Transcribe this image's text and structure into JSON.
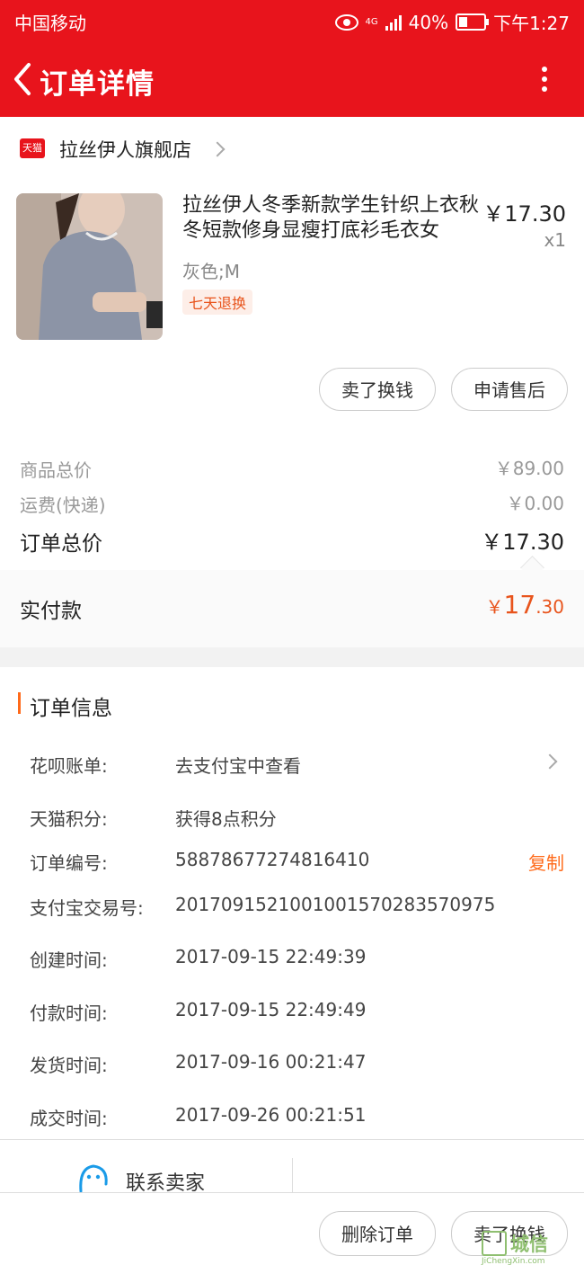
{
  "status_bar": {
    "carrier": "中国移动",
    "network": "4G",
    "battery": "40%",
    "time": "下午1:27"
  },
  "nav": {
    "title": "订单详情"
  },
  "store": {
    "badge": "天猫",
    "name": "拉丝伊人旗舰店"
  },
  "product": {
    "name": "拉丝伊人冬季新款学生针织上衣秋冬短款修身显瘦打底衫毛衣女",
    "price": "￥17.30",
    "quantity": "x1",
    "sku": "灰色;M",
    "tag": "七天退换"
  },
  "product_actions": {
    "sell": "卖了换钱",
    "after_sale": "申请售后"
  },
  "totals": {
    "goods_label": "商品总价",
    "goods_value": "￥89.00",
    "shipping_label": "运费(快递)",
    "shipping_value": "￥0.00",
    "order_label": "订单总价",
    "order_value": "￥17.30",
    "paid_label": "实付款",
    "paid_currency": "￥",
    "paid_int": "17",
    "paid_dec": ".30"
  },
  "order_info": {
    "title": "订单信息",
    "rows": [
      {
        "label": "花呗账单:",
        "value": "去支付宝中查看"
      },
      {
        "label": "天猫积分:",
        "value": "获得8点积分"
      },
      {
        "label": "订单编号:",
        "value": "58878677274816410"
      },
      {
        "label": "支付宝交易号:",
        "value": "2017091521001001570283570975"
      },
      {
        "label": "创建时间:",
        "value": "2017-09-15 22:49:39"
      },
      {
        "label": "付款时间:",
        "value": "2017-09-15 22:49:49"
      },
      {
        "label": "发货时间:",
        "value": "2017-09-16 00:21:47"
      },
      {
        "label": "成交时间:",
        "value": "2017-09-26 00:21:51"
      }
    ],
    "copy": "复制"
  },
  "bottom": {
    "contact": "联系卖家",
    "delete": "删除订单",
    "sell": "卖了换钱"
  },
  "watermark": {
    "text": "城信",
    "sub": "JiChengXin.com"
  },
  "colors": {
    "header": "#e8141c",
    "accent": "#ff6a1a",
    "price": "#e8541c"
  }
}
